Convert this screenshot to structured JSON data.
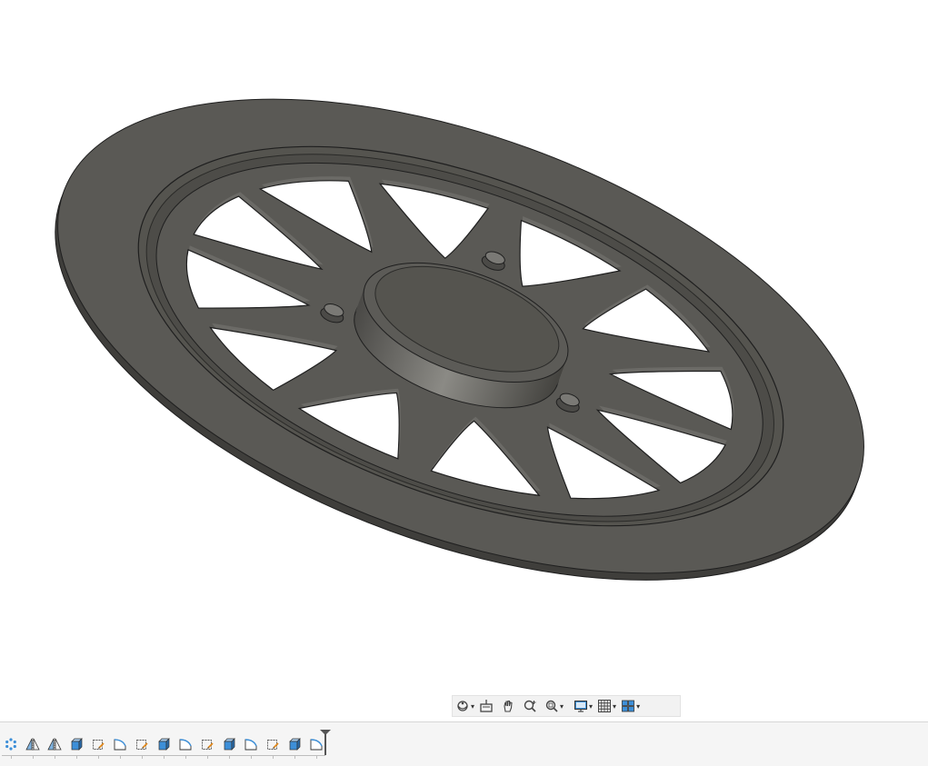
{
  "viewport": {
    "model": "wheel-disc-with-twelve-cutouts",
    "background_color": "#ffffff",
    "body_color": "#5a5955",
    "edge_color": "#1f1f1f"
  },
  "navigation_bar": {
    "buttons": [
      {
        "icon": "orbit-icon",
        "dropdown": true
      },
      {
        "icon": "look-at-icon",
        "dropdown": false
      },
      {
        "icon": "pan-icon",
        "dropdown": false
      },
      {
        "icon": "zoom-icon",
        "dropdown": false
      },
      {
        "icon": "fit-icon",
        "dropdown": true
      },
      {
        "icon": "display-settings-icon",
        "dropdown": true
      },
      {
        "icon": "grid-icon",
        "dropdown": true
      },
      {
        "icon": "viewports-icon",
        "dropdown": true
      }
    ],
    "caret": "▾"
  },
  "timeline": {
    "features": [
      "circular-pattern-icon",
      "mirror-icon",
      "mirror-icon",
      "extrude-icon",
      "sketch-icon",
      "fillet-icon",
      "sketch-icon",
      "extrude-icon",
      "fillet-icon",
      "sketch-icon",
      "extrude-icon",
      "fillet-icon",
      "sketch-icon",
      "extrude-icon",
      "fillet-icon"
    ],
    "accent_color": "#3d8fd8"
  }
}
